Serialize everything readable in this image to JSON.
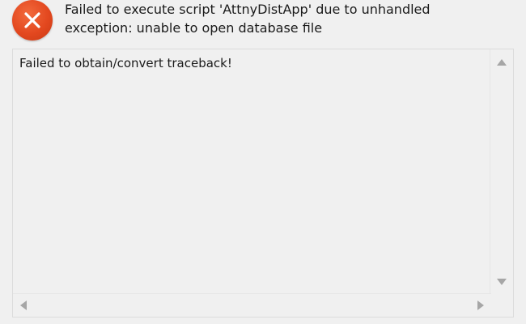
{
  "dialog": {
    "icon": "error-circle-x-icon",
    "message_lines": [
      "Failed to execute script 'AttnyDistApp' due to unhandled",
      "exception: unable to open database file"
    ],
    "details_text": "Failed to obtain/convert traceback!"
  },
  "colors": {
    "error_icon": "#e3481f",
    "background": "#f0f0f0",
    "scroll_arrow": "#a6a6a6"
  }
}
